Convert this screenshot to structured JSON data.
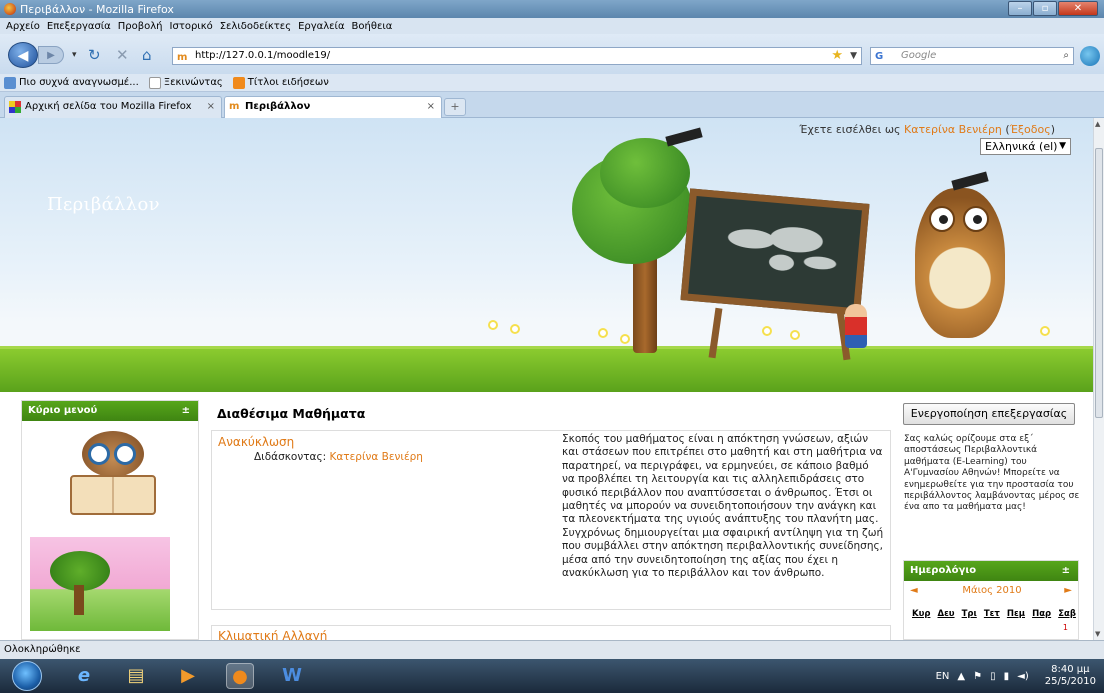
{
  "window": {
    "title": "Περιβάλλον - Mozilla Firefox",
    "controls": [
      "–",
      "▫",
      "✕"
    ]
  },
  "menu": [
    "Αρχείο",
    "Επεξεργασία",
    "Προβολή",
    "Ιστορικό",
    "Σελιδοδείκτες",
    "Εργαλεία",
    "Βοήθεια"
  ],
  "nav": {
    "url": "http://127.0.0.1/moodle19/",
    "search_placeholder": "Google",
    "search_engine": "G"
  },
  "bookmarks": [
    "Πιο συχνά αναγνωσμέ...",
    "Ξεκινώντας",
    "Τίτλοι ειδήσεων"
  ],
  "tabs": [
    {
      "label": "Αρχική σελίδα του Mozilla Firefox",
      "active": false
    },
    {
      "label": "Περιβάλλον",
      "active": true
    }
  ],
  "header": {
    "site_name": "Περιβάλλον",
    "login_prefix": "Έχετε εισέλθει ως ",
    "user": "Κατερίνα Βενιέρη",
    "logout_open": " (",
    "logout": "Έξοδος",
    "logout_close": ")",
    "language": "Ελληνικά (el)"
  },
  "left": {
    "main_menu_title": "Κύριο μενού",
    "toggle": "±"
  },
  "center": {
    "heading": "Διαθέσιμα Μαθήματα",
    "courses": [
      {
        "name": "Ανακύκλωση",
        "teacher_label": "Διδάσκοντας: ",
        "teacher": "Κατερίνα Βενιέρη",
        "summary": "Σκοπός του μαθήματος είναι η απόκτηση γνώσεων, αξιών και στάσεων που επιτρέπει στο μαθητή και στη μαθήτρια να παρατηρεί, να περιγράφει, να ερμηνεύει, σε κάποιο βαθμό να προβλέπει τη λειτουργία και τις αλληλεπιδράσεις στο φυσικό περιβάλλον που αναπτύσσεται ο άνθρωπος. Έτσι οι μαθητές να μπορούν να συνειδητοποιήσουν την ανάγκη και τα πλεονεκτήματα της υγιούς ανάπτυξης του πλανήτη μας. Συγχρόνως δημιουργείται μια σφαιρική αντίληψη για τη ζωή που συμβάλλει στην απόκτηση περιβαλλοντικής συνείδησης, μέσα από την συνειδητοποίηση της αξίας που έχει η ανακύκλωση για το περιβάλλον και τον άνθρωπο."
      },
      {
        "name": "Κλιματική Αλλαγή"
      }
    ]
  },
  "right": {
    "edit_button": "Ενεργοποίηση επεξεργασίας",
    "welcome": "Σας καλώς ορίζουμε στα εξ΄ αποστάσεως Περιβαλλοντικά μαθήματα (E-Learning) του Α'Γυμνασίου Αθηνών! Μπορείτε να ενημερωθείτε για την προστασία του περιβάλλοντος λαμβάνοντας μέρος σε ένα απο τα μαθήματα μας!",
    "calendar": {
      "title": "Ημερολόγιο",
      "toggle": "±",
      "month": "Μάιος 2010",
      "prev": "◄",
      "next": "►",
      "days": [
        "Κυρ",
        "Δευ",
        "Τρι",
        "Τετ",
        "Πεμ",
        "Παρ",
        "Σαβ"
      ],
      "first_day": "1"
    }
  },
  "status": "Ολοκληρώθηκε",
  "tray": {
    "lang": "EN",
    "time": "8:40 μμ",
    "date": "25/5/2010"
  },
  "colors": {
    "accent": "#e07a17",
    "block_header": "#4c9a17",
    "ground": "#6cb326"
  }
}
